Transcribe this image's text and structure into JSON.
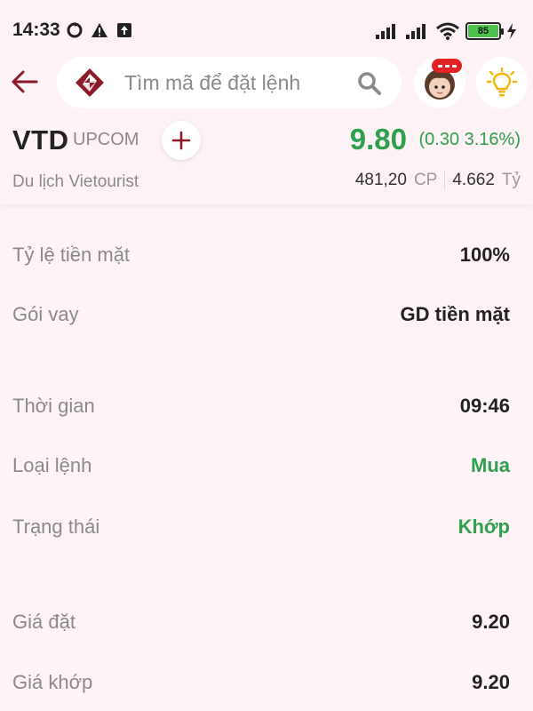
{
  "status_bar": {
    "time": "14:33",
    "battery": "85"
  },
  "header": {
    "search_placeholder": "Tìm mã để đặt lệnh"
  },
  "stock": {
    "symbol": "VTD",
    "exchange": "UPCOM",
    "price": "9.80",
    "change": "(0.30 3.16%)",
    "company": "Du lịch Vietourist",
    "volume": "481,20",
    "volume_unit": "CP",
    "value": "4.662",
    "value_unit": "Tỷ"
  },
  "section_1": {
    "rows": [
      {
        "label": "Tỷ lệ tiền mặt",
        "value": "100%"
      },
      {
        "label": "Gói vay",
        "value": "GD tiền mặt"
      }
    ]
  },
  "section_2": {
    "rows": [
      {
        "label": "Thời gian",
        "value": "09:46"
      },
      {
        "label": "Loại lệnh",
        "value": "Mua"
      },
      {
        "label": "Trạng thái",
        "value": "Khớp"
      }
    ]
  },
  "section_3": {
    "rows": [
      {
        "label": "Giá đặt",
        "value": "9.20"
      },
      {
        "label": "Giá khớp",
        "value": "9.20"
      }
    ]
  },
  "colors": {
    "accent": "#8b1a2b",
    "positive": "#2fa04e",
    "background": "#fdf2f6"
  }
}
